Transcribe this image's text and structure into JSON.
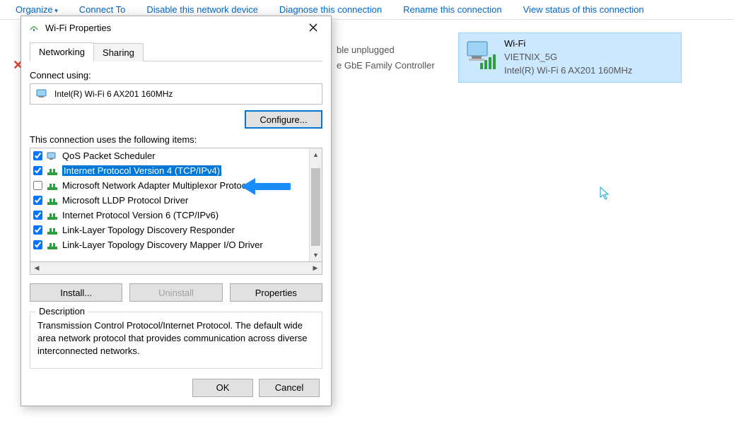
{
  "toolbar": {
    "organize": "Organize",
    "connect_to": "Connect To",
    "disable": "Disable this network device",
    "diagnose": "Diagnose this connection",
    "rename": "Rename this connection",
    "view_status": "View status of this connection"
  },
  "background": {
    "partial_line1": "ble unplugged",
    "partial_line2": "e GbE Family Controller",
    "wifi_tile": {
      "title": "Wi-Fi",
      "ssid": "VIETNIX_5G",
      "adapter": "Intel(R) Wi-Fi 6 AX201 160MHz"
    }
  },
  "dialog": {
    "title": "Wi-Fi Properties",
    "tabs": {
      "networking": "Networking",
      "sharing": "Sharing"
    },
    "connect_using_label": "Connect using:",
    "adapter_name": "Intel(R) Wi-Fi 6 AX201 160MHz",
    "configure_btn": "Configure...",
    "items_label": "This connection uses the following items:",
    "items": [
      {
        "checked": true,
        "label": "QoS Packet Scheduler",
        "icon": "service"
      },
      {
        "checked": true,
        "label": "Internet Protocol Version 4 (TCP/IPv4)",
        "icon": "protocol",
        "selected": true
      },
      {
        "checked": false,
        "label": "Microsoft Network Adapter Multiplexor Protocol",
        "icon": "protocol"
      },
      {
        "checked": true,
        "label": "Microsoft LLDP Protocol Driver",
        "icon": "protocol"
      },
      {
        "checked": true,
        "label": "Internet Protocol Version 6 (TCP/IPv6)",
        "icon": "protocol"
      },
      {
        "checked": true,
        "label": "Link-Layer Topology Discovery Responder",
        "icon": "protocol"
      },
      {
        "checked": true,
        "label": "Link-Layer Topology Discovery Mapper I/O Driver",
        "icon": "protocol"
      }
    ],
    "install_btn": "Install...",
    "uninstall_btn": "Uninstall",
    "properties_btn": "Properties",
    "desc_legend": "Description",
    "desc_text": "Transmission Control Protocol/Internet Protocol. The default wide area network protocol that provides communication across diverse interconnected networks.",
    "ok_btn": "OK",
    "cancel_btn": "Cancel"
  }
}
